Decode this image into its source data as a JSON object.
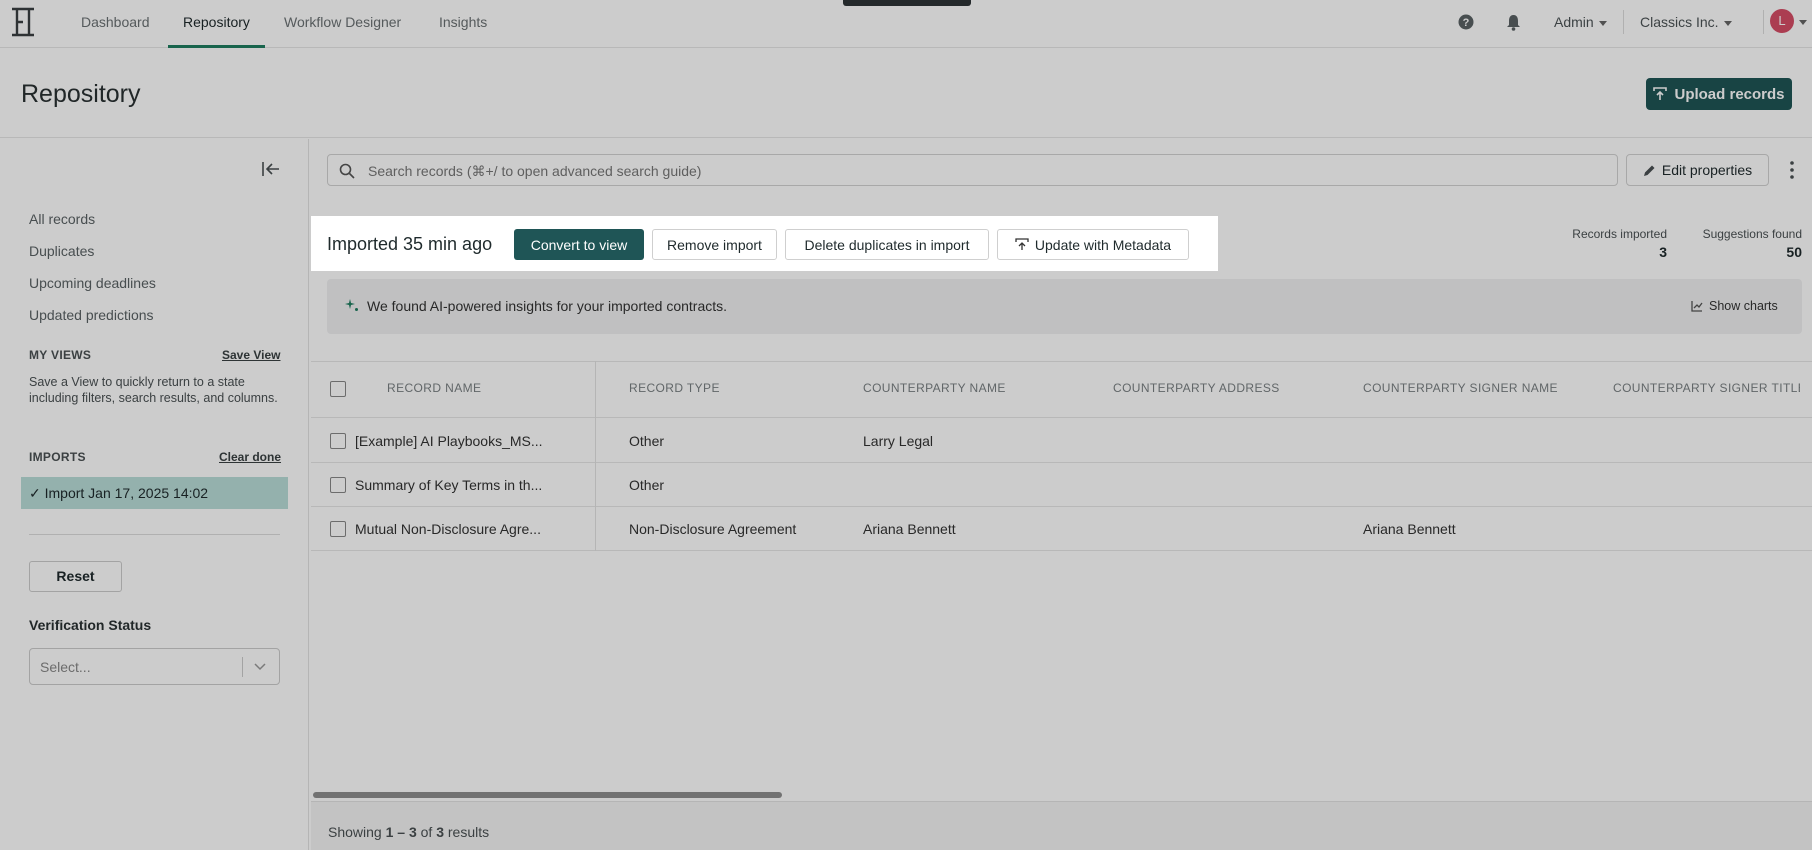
{
  "nav": {
    "tabs": [
      "Dashboard",
      "Repository",
      "Workflow Designer",
      "Insights"
    ],
    "active_tab": "Repository",
    "user_menu": "Admin",
    "org_menu": "Classics Inc.",
    "avatar_initial": "L"
  },
  "header": {
    "title": "Repository",
    "upload_label": "Upload records"
  },
  "sidebar": {
    "links": [
      "All records",
      "Duplicates",
      "Upcoming deadlines",
      "Updated predictions"
    ],
    "my_views_heading": "MY VIEWS",
    "save_view_label": "Save View",
    "views_help": "Save a View to quickly return to a state including filters, search results, and columns.",
    "imports_heading": "IMPORTS",
    "clear_done_label": "Clear done",
    "import_item": "✓ Import Jan 17, 2025 14:02",
    "reset_label": "Reset",
    "verification_label": "Verification Status",
    "verification_placeholder": "Select..."
  },
  "toolbar": {
    "search_placeholder": "Search records (⌘+/ to open advanced search guide)",
    "edit_properties_label": "Edit properties"
  },
  "import_bar": {
    "title": "Imported 35 min ago",
    "convert_label": "Convert to view",
    "remove_label": "Remove import",
    "delete_dup_label": "Delete duplicates in import",
    "update_meta_label": "Update with Metadata"
  },
  "stats": {
    "records_imported_label": "Records imported",
    "records_imported_value": "3",
    "suggestions_label": "Suggestions found",
    "suggestions_value": "50"
  },
  "insights": {
    "message": "We found AI-powered insights for your imported contracts.",
    "show_charts_label": "Show charts"
  },
  "table": {
    "columns": [
      "RECORD NAME",
      "RECORD TYPE",
      "COUNTERPARTY NAME",
      "COUNTERPARTY ADDRESS",
      "COUNTERPARTY SIGNER NAME",
      "COUNTERPARTY SIGNER TITLE"
    ],
    "rows": [
      {
        "name": "[Example] AI Playbooks_MS...",
        "type": "Other",
        "counterparty": "Larry Legal",
        "address": "",
        "signer": "",
        "title": ""
      },
      {
        "name": "Summary of Key Terms in th...",
        "type": "Other",
        "counterparty": "",
        "address": "",
        "signer": "",
        "title": ""
      },
      {
        "name": "Mutual Non-Disclosure Agre...",
        "type": "Non-Disclosure Agreement",
        "counterparty": "Ariana Bennett",
        "address": "",
        "signer": "Ariana Bennett",
        "title": ""
      }
    ]
  },
  "footer": {
    "showing_prefix": "Showing ",
    "range": "1 – 3",
    "of_text": " of ",
    "total": "3",
    "suffix": " results"
  },
  "colors": {
    "brand": "#1f5556",
    "active_tab_underline": "#1e7d5f",
    "selected_import_bg": "#b9ded9",
    "avatar": "#d64d66"
  }
}
